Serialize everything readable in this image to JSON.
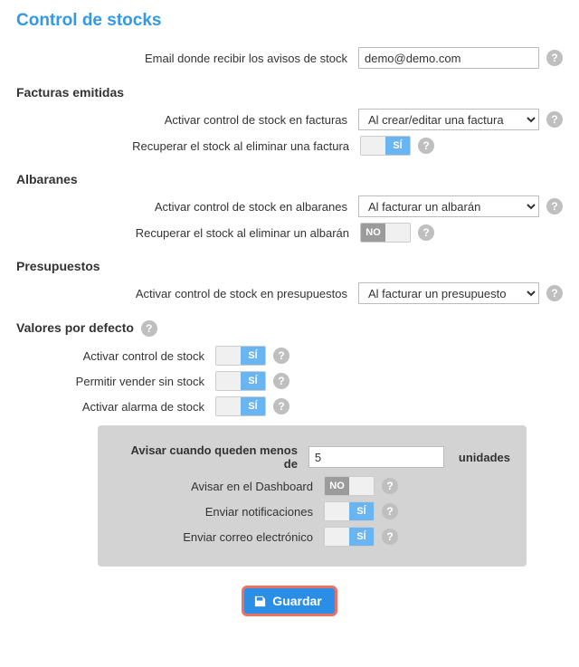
{
  "page_title": "Control de stocks",
  "toggle_labels": {
    "on": "SÍ",
    "off": "NO"
  },
  "email": {
    "label": "Email donde recibir los avisos de stock",
    "value": "demo@demo.com"
  },
  "sections": {
    "facturas": {
      "title": "Facturas emitidas",
      "activar_label": "Activar control de stock en facturas",
      "activar_value": "Al crear/editar una factura",
      "recuperar_label": "Recuperar el stock al eliminar una factura",
      "recuperar_value": true
    },
    "albaranes": {
      "title": "Albaranes",
      "activar_label": "Activar control de stock en albaranes",
      "activar_value": "Al facturar un albarán",
      "recuperar_label": "Recuperar el stock al eliminar un albarán",
      "recuperar_value": false
    },
    "presupuestos": {
      "title": "Presupuestos",
      "activar_label": "Activar control de stock en presupuestos",
      "activar_value": "Al facturar un presupuesto"
    }
  },
  "defaults": {
    "title": "Valores por defecto",
    "items": {
      "control": {
        "label": "Activar control de stock",
        "value": true
      },
      "sinstock": {
        "label": "Permitir vender sin stock",
        "value": true
      },
      "alarma": {
        "label": "Activar alarma de stock",
        "value": true
      }
    },
    "panel": {
      "threshold_label": "Avisar cuando queden menos de",
      "threshold_value": "5",
      "threshold_units": "unidades",
      "dashboard": {
        "label": "Avisar en el Dashboard",
        "value": false
      },
      "notificaciones": {
        "label": "Enviar notificaciones",
        "value": true
      },
      "correo": {
        "label": "Enviar correo electrónico",
        "value": true
      }
    }
  },
  "save_label": "Guardar"
}
